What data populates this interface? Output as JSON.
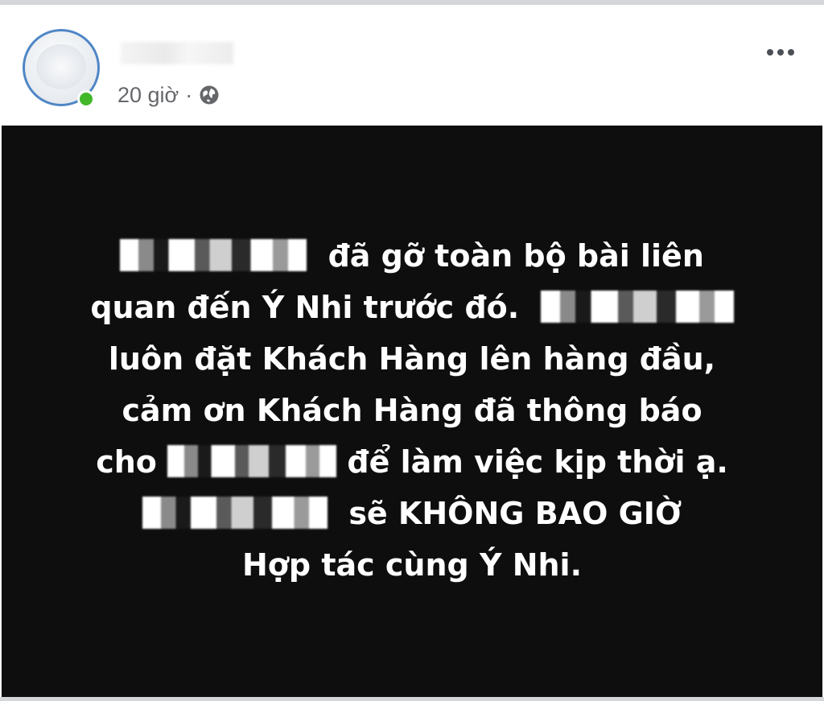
{
  "post": {
    "author_name": "",
    "timestamp": "20 giờ",
    "separator": "·",
    "audience_icon": "globe-icon",
    "more_icon": "more-options-icon",
    "presence": "online",
    "online_color": "#42b72a"
  },
  "status": {
    "background_color": "#0e0e0e",
    "text_color": "#ffffff",
    "lines": [
      "đã gỡ toàn bộ bài liên",
      "quan đến Ý Nhi trước đó.",
      "luôn đặt Khách Hàng lên hàng đầu,",
      "cảm ơn Khách Hàng đã thông báo",
      "cho",
      "để làm việc kịp thời ạ.",
      "sẽ KHÔNG BAO GIỜ",
      "Hợp tác cùng Ý Nhi."
    ]
  }
}
